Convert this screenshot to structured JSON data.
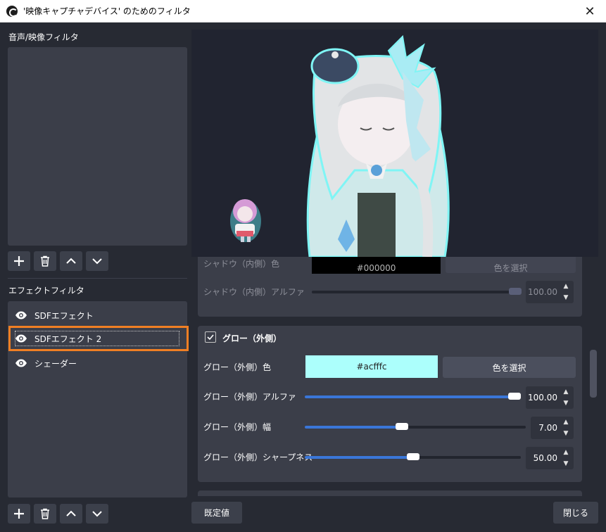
{
  "window": {
    "title": "'映像キャプチャデバイス' のためのフィルタ",
    "close_label": "✕"
  },
  "left": {
    "audio_video_label": "音声/映像フィルタ",
    "effect_label": "エフェクトフィルタ",
    "effects": [
      {
        "label": "SDFエフェクト",
        "selected": false
      },
      {
        "label": "SDFエフェクト 2",
        "selected": true
      },
      {
        "label": "シェーダー",
        "selected": false
      }
    ]
  },
  "props": {
    "shadow_color_label": "シャドウ（内側）色",
    "shadow_color_value": "#000000",
    "shadow_color_button": "色を選択",
    "shadow_alpha_label": "シャドウ（内側）アルファ",
    "shadow_alpha_value": "100.00",
    "shadow_alpha_fraction": 1.0,
    "glow_section_label": "グロー（外側）",
    "glow_enabled": true,
    "glow_color_label": "グロー（外側）色",
    "glow_color_value": "#acfffc",
    "glow_color_button": "色を選択",
    "glow_alpha_label": "グロー（外側）アルファ",
    "glow_alpha_value": "100.00",
    "glow_alpha_fraction": 1.0,
    "glow_width_label": "グロー（外側）幅",
    "glow_width_value": "7.00",
    "glow_width_fraction": 0.44,
    "glow_sharpness_label": "グロー（外側）シャープネス",
    "glow_sharpness_value": "50.00",
    "glow_sharpness_fraction": 0.5
  },
  "footer": {
    "defaults_label": "既定値",
    "close_label": "閉じる"
  },
  "colors": {
    "accent_blue": "#3a76d8",
    "selection_orange": "#f07f24",
    "glow_color": "#acfffc",
    "shadow_color": "#000000"
  }
}
